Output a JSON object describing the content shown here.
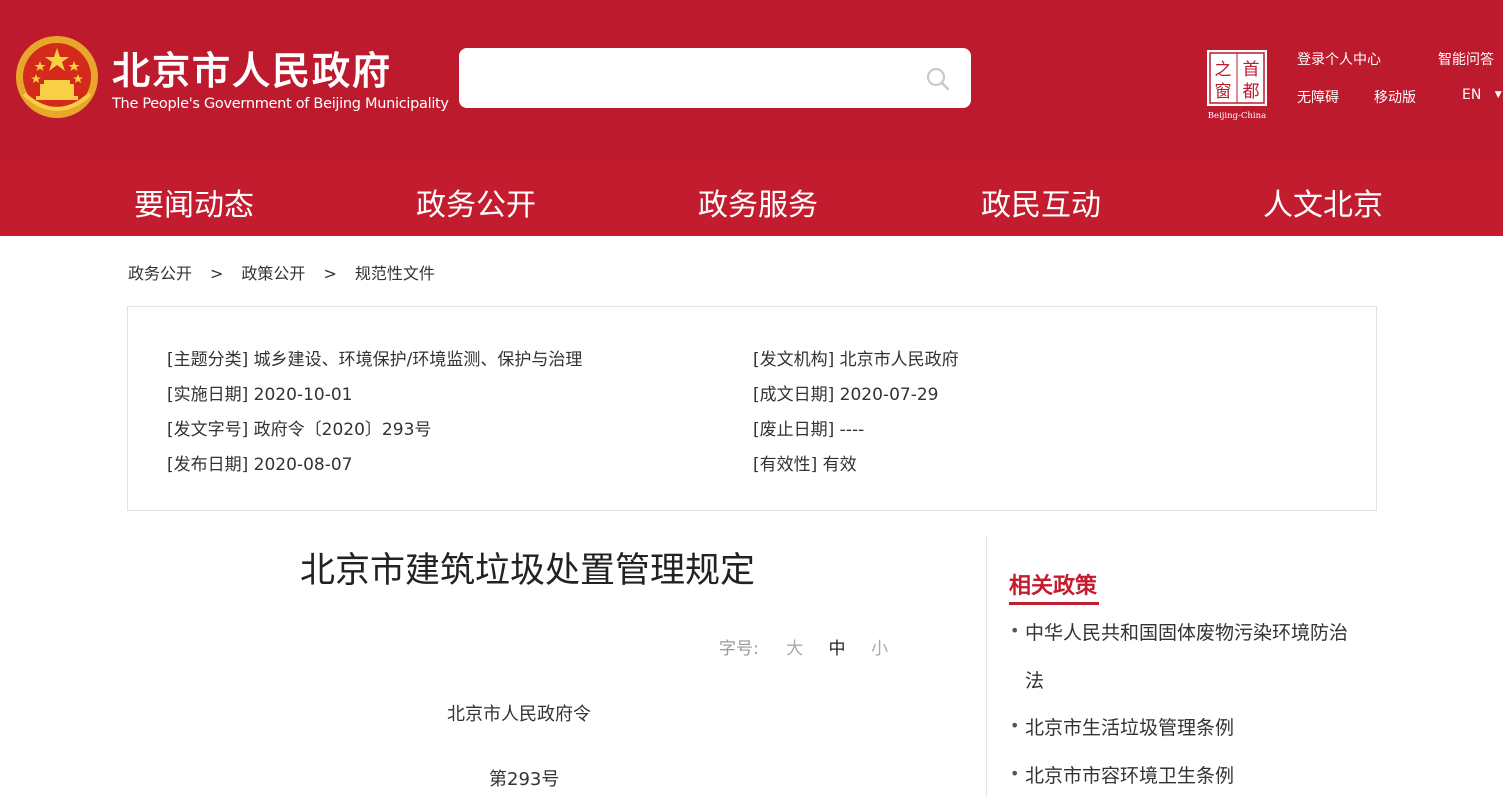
{
  "header": {
    "site_title": "北京市人民政府",
    "site_subtitle": "The People's Government of Beijing Municipality",
    "search_placeholder": "",
    "capital_logo_text": [
      "之",
      "首",
      "窗",
      "都"
    ],
    "capital_logo_caption": "Beijing-China",
    "links": {
      "login": "登录个人中心",
      "smart_qa": "智能问答",
      "accessibility": "无障碍",
      "mobile": "移动版",
      "language": "EN",
      "language_arrow": "▼"
    },
    "brand_color": "#bd1a2d"
  },
  "nav": {
    "items": [
      "要闻动态",
      "政务公开",
      "政务服务",
      "政民互动",
      "人文北京"
    ]
  },
  "breadcrumb": {
    "items": [
      "政务公开",
      "政策公开",
      "规范性文件"
    ],
    "separator": ">"
  },
  "meta": {
    "topic_label": "[主题分类]",
    "topic_value": "城乡建设、环境保护/环境监测、保护与治理",
    "issuer_label": "[发文机构]",
    "issuer_value": "北京市人民政府",
    "effective_label": "[实施日期]",
    "effective_value": "2020-10-01",
    "written_label": "[成文日期]",
    "written_value": "2020-07-29",
    "docno_label": "[发文字号]",
    "docno_value": "政府令〔2020〕293号",
    "repeal_label": "[废止日期]",
    "repeal_value": "----",
    "publish_label": "[发布日期]",
    "publish_value": "2020-08-07",
    "validity_label": "[有效性]",
    "validity_value": "有效"
  },
  "article": {
    "title": "北京市建筑垃圾处置管理规定",
    "font_size_label": "字号:",
    "font_size_options": [
      "大",
      "中",
      "小"
    ],
    "order_line": "北京市人民政府令",
    "number_line": "第293号"
  },
  "related": {
    "title": "相关政策",
    "items": [
      "中华人民共和国固体废物污染环境防治",
      "法",
      "北京市生活垃圾管理条例",
      "北京市市容环境卫生条例"
    ]
  }
}
